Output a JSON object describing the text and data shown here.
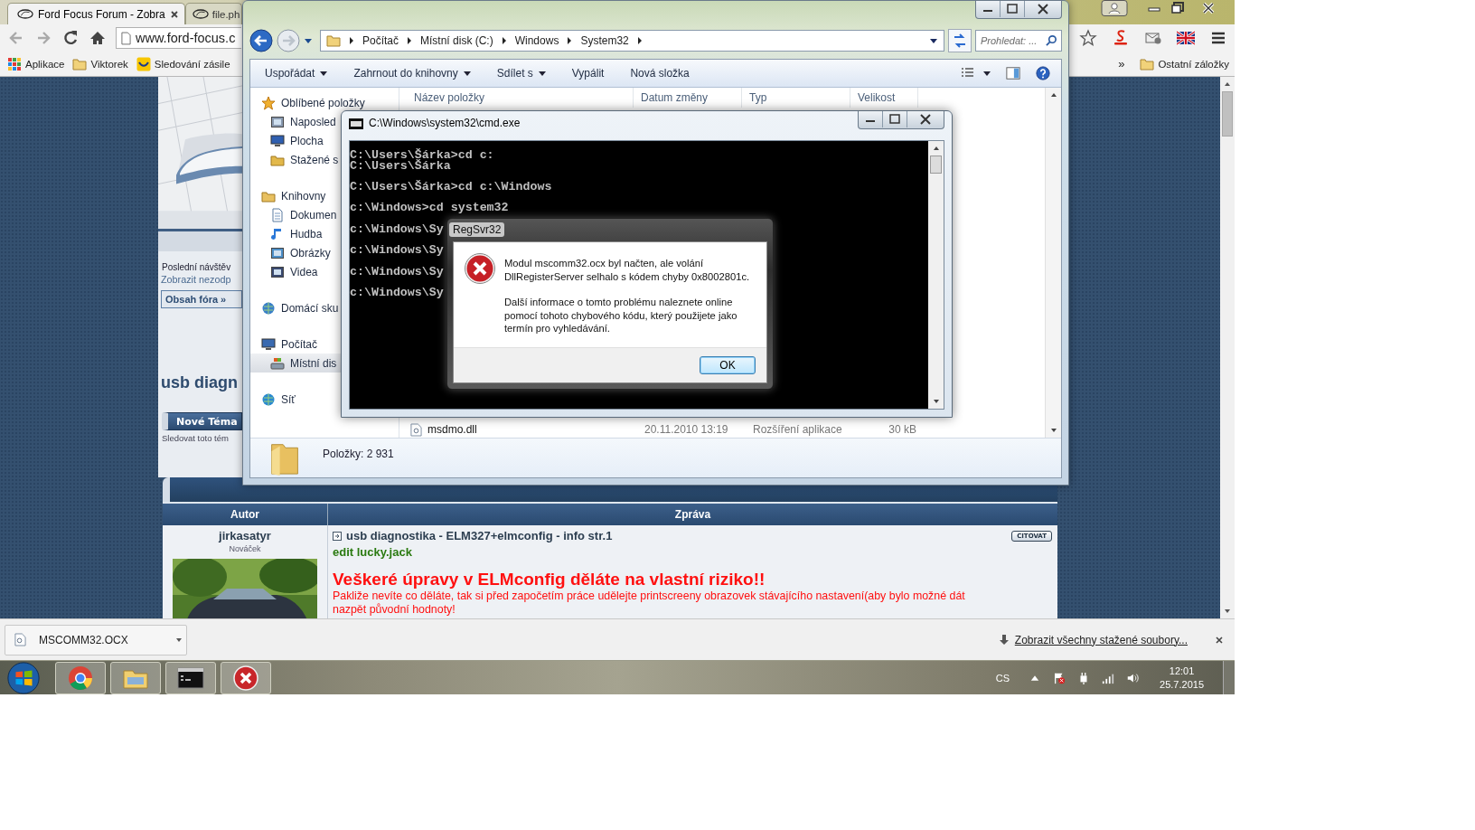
{
  "browser": {
    "tabs": [
      {
        "title": "Ford Focus Forum - Zobra",
        "selected": true
      },
      {
        "title": "file.ph",
        "selected": false
      }
    ],
    "address": "www.ford-focus.c",
    "bookmarks": [
      {
        "label": "Aplikace",
        "kind": "apps"
      },
      {
        "label": "Viktorek",
        "kind": "folder"
      },
      {
        "label": "Sledování zásile",
        "kind": "site"
      }
    ],
    "more_bookmarks": "»",
    "other_bookmarks": "Ostatní záložky"
  },
  "forum": {
    "last_visit": "Poslední návštěv",
    "unanswered_link": "Zobrazit nezodp",
    "breadcrumb": "Obsah fóra »",
    "topic_title": "usb diagn",
    "new_topic_button": "Nové Téma",
    "watch_topic": "Sledovat toto tém",
    "columns": [
      "Autor",
      "Zpráva"
    ],
    "post": {
      "author": "jirkasatyr",
      "rank": "Nováček",
      "title": "usb diagnostika - ELM327+elmconfig - info str.1",
      "quote_button": "CITOVAT",
      "edit_note": "edit lucky.jack",
      "warning": "Veškeré úpravy v ELMconfig děláte na vlastní riziko!!",
      "text": "Pakliže nevíte co děláte, tak si před započetím práce udělejte printscreeny obrazovek stávajícího nastavení(aby bylo možné dát nazpět původní hodnoty!"
    }
  },
  "downloads": {
    "items": [
      {
        "name": "MSCOMM32.OCX"
      }
    ],
    "show_all": "Zobrazit všechny stažené soubory..."
  },
  "explorer": {
    "path": [
      "Počítač",
      "Místní disk (C:)",
      "Windows",
      "System32"
    ],
    "search_placeholder": "Prohledat: ...",
    "commands": [
      {
        "label": "Uspořádat",
        "menu": true
      },
      {
        "label": "Zahrnout do knihovny",
        "menu": true
      },
      {
        "label": "Sdílet s",
        "menu": true
      },
      {
        "label": "Vypálit",
        "menu": false
      },
      {
        "label": "Nová složka",
        "menu": false
      }
    ],
    "nav": [
      {
        "label": "Oblíbené položky",
        "kind": "favorites",
        "selected": false,
        "children": [
          {
            "label": "Naposled",
            "kind": "recent",
            "selected": false
          },
          {
            "label": "Plocha",
            "kind": "desktop",
            "selected": false
          },
          {
            "label": "Stažené s",
            "kind": "downloads",
            "selected": false
          }
        ]
      },
      {
        "label": "Knihovny",
        "kind": "libraries",
        "selected": false,
        "children": [
          {
            "label": "Dokumen",
            "kind": "documents",
            "selected": false
          },
          {
            "label": "Hudba",
            "kind": "music",
            "selected": false
          },
          {
            "label": "Obrázky",
            "kind": "pictures",
            "selected": false
          },
          {
            "label": "Videa",
            "kind": "videos",
            "selected": false
          }
        ]
      },
      {
        "label": "Domácí sku",
        "kind": "homegroup",
        "selected": false
      },
      {
        "label": "Počítač",
        "kind": "computer",
        "selected": false,
        "children": [
          {
            "label": "Místní dis",
            "kind": "disk",
            "selected": true
          }
        ]
      },
      {
        "label": "Síť",
        "kind": "network",
        "selected": false
      }
    ],
    "columns": [
      "Název položky",
      "Datum změny",
      "Typ",
      "Velikost"
    ],
    "files": [
      {
        "name": "msdmo.dll",
        "date": "20.11.2010 13:19",
        "type": "Rozšíření aplikace",
        "size": "30 kB"
      }
    ],
    "item_count": "Položky: 2 931"
  },
  "cmd": {
    "title": "C:\\Windows\\system32\\cmd.exe",
    "lines": [
      {
        "text": "C:\\Users\\Šárka>cd c:",
        "gap_before": false
      },
      {
        "text": "C:\\Users\\Šárka",
        "gap_before": false
      },
      {
        "text": "C:\\Users\\Šárka>cd c:\\Windows",
        "gap_before": true
      },
      {
        "text": "c:\\Windows>cd system32",
        "gap_before": true
      },
      {
        "text": "c:\\Windows\\Sy",
        "gap_before": true
      },
      {
        "text": "c:\\Windows\\Sy",
        "gap_before": true
      },
      {
        "text": "c:\\Windows\\Sy",
        "gap_before": true
      },
      {
        "text": "c:\\Windows\\Sy",
        "gap_before": true
      }
    ]
  },
  "dialog": {
    "title": "RegSvr32",
    "message": [
      "Modul mscomm32.ocx byl načten, ale volání DllRegisterServer selhalo s kódem chyby 0x8002801c.",
      "Další informace o tomto problému naleznete online pomocí tohoto chybového kódu, který použijete jako termín pro vyhledávání."
    ],
    "ok": "OK"
  },
  "taskbar": {
    "apps": [
      {
        "kind": "chrome"
      },
      {
        "kind": "explorer"
      },
      {
        "kind": "cmd"
      },
      {
        "kind": "error"
      }
    ],
    "language": "CS",
    "time": "12:01",
    "date": "25.7.2015"
  }
}
